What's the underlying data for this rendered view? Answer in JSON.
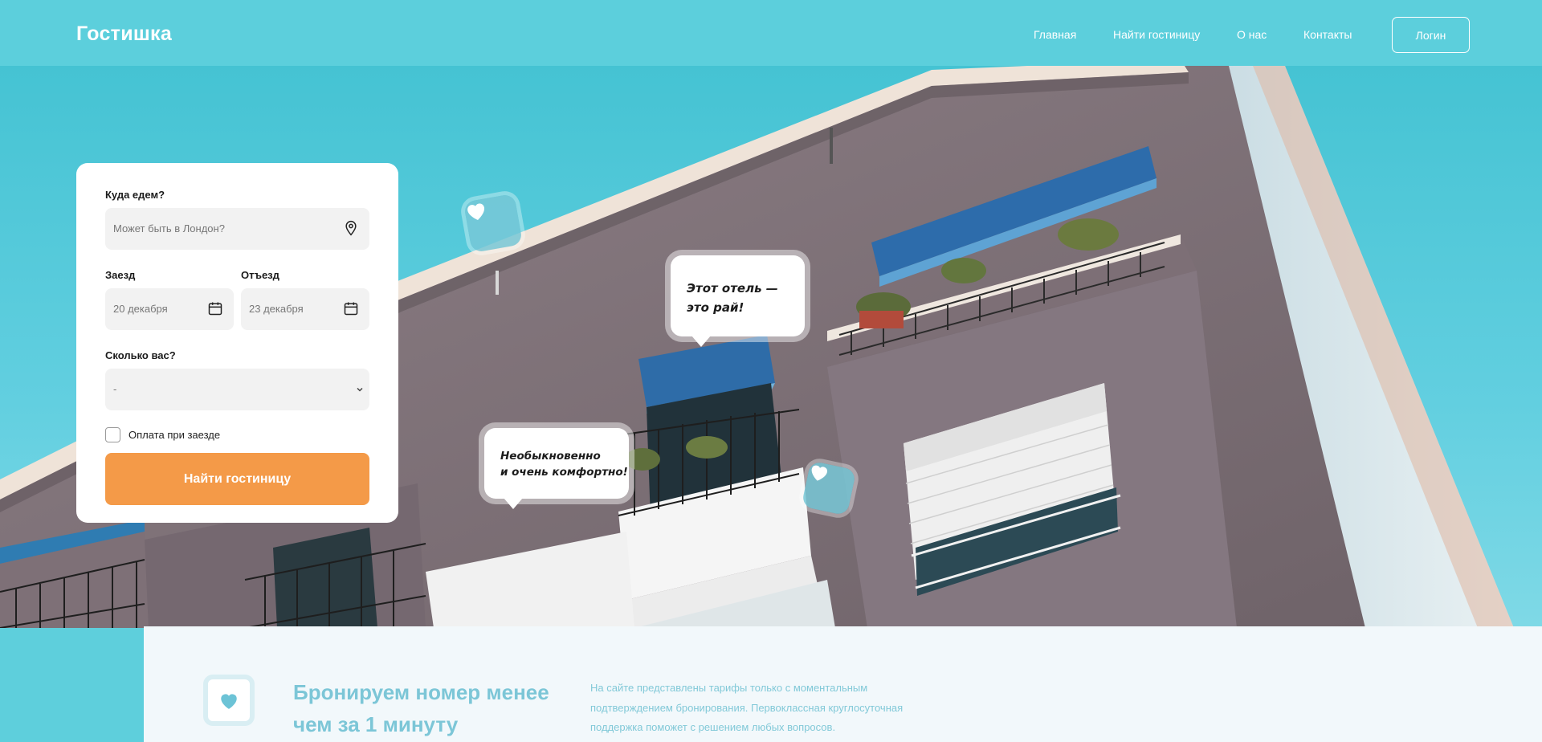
{
  "header": {
    "logo": "Гостишка",
    "nav": [
      "Главная",
      "Найти гостиницу",
      "О нас",
      "Контакты"
    ],
    "login_label": "Логин"
  },
  "form": {
    "destination_label": "Куда едем?",
    "destination_placeholder": "Может быть в Лондон?",
    "checkin_label": "Заезд",
    "checkin_value": "20 декабря",
    "checkout_label": "Отъезд",
    "checkout_value": "23 декабря",
    "guests_label": "Сколько вас?",
    "guests_value": "-",
    "pay_on_arrival_label": "Оплата при заезде",
    "submit_label": "Найти гостиницу"
  },
  "bubbles": {
    "review_1_line1": "Этот отель —",
    "review_1_line2": "это рай!",
    "review_2_line1": "Необыкновенно",
    "review_2_line2": "и очень комфортно!"
  },
  "feature": {
    "title": "Бронируем номер менее чем за 1 минуту",
    "text": "На сайте представлены тарифы только с моментальным подтверждением бронирования. Первоклассная круглосуточная поддержка поможет с решением любых вопросов."
  },
  "icons": {
    "location": "location-pin-icon",
    "calendar": "calendar-icon",
    "select": "chevron-down-icon",
    "heart": "heart-icon"
  },
  "colors": {
    "brand": "#5ccfdc",
    "accent": "#f49a48",
    "feature_text": "#7cc6d7"
  }
}
